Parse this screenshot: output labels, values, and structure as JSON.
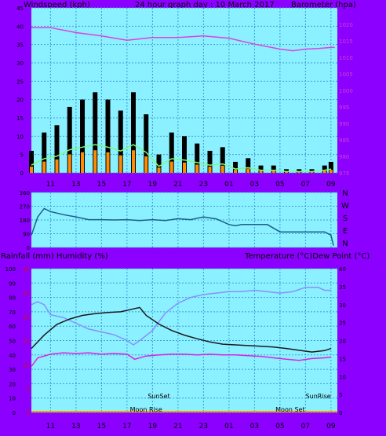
{
  "header": {
    "left_label": "Windspeed (kph)",
    "title": "24 hour graph day : 10 March 2017",
    "right_label": "Barometer (hpa)"
  },
  "bottom_header": {
    "left_label": "Rainfall (mm)  Humidity (%)",
    "right_label": "Temperature (°C)Dew Point (°C)"
  },
  "colors": {
    "plot_bg": "#8bf0ff",
    "grid": "#3c9fd0",
    "windspeed": "#000000",
    "gust_fill": "#ff8c00",
    "avg_wind": "#7cfc7c",
    "barometer": "#e040e0",
    "direction": "#1b5f86",
    "temperature": "#1a1a1a",
    "dew_point": "#e020e0",
    "humidity": "#8890ff",
    "rain": "#ffa000"
  },
  "chart_data": [
    {
      "type": "line",
      "title": "24 hour graph day : 10 March 2017",
      "xlabel": "",
      "ylabel_left": "Windspeed (kph)",
      "ylabel_right": "Barometer (hpa)",
      "x_ticks": [
        "11",
        "13",
        "15",
        "17",
        "19",
        "21",
        "23",
        "01",
        "03",
        "05",
        "07",
        "09"
      ],
      "y_left_ticks": [
        0,
        5,
        10,
        15,
        20,
        25,
        30,
        35,
        40,
        45
      ],
      "ylim_left": [
        0,
        45
      ],
      "y_right_ticks": [
        975,
        980,
        985,
        990,
        995,
        1000,
        1005,
        1010,
        1015,
        1020
      ],
      "ylim_right": [
        975,
        1025
      ],
      "grid": true,
      "series": [
        {
          "name": "Windspeed (kph)",
          "axis": "left",
          "x": [
            9.5,
            10.5,
            11.5,
            12.5,
            13.5,
            14.5,
            15.5,
            16.5,
            17.5,
            18.5,
            19.5,
            20.5,
            21.5,
            22.5,
            23.5,
            24.5,
            25.5,
            26.5,
            27.5,
            28.5,
            29.5,
            30.5,
            31.5,
            32.5,
            33
          ],
          "y": [
            6,
            11,
            13,
            18,
            20,
            22,
            20,
            17,
            22,
            16,
            5,
            11,
            10,
            8,
            6,
            7,
            3,
            4,
            2,
            2,
            1,
            1,
            1,
            2,
            3
          ]
        },
        {
          "name": "Barometer (hpa)",
          "axis": "right",
          "x": [
            9.5,
            11,
            13,
            15,
            17,
            19,
            21,
            23,
            25,
            27,
            29,
            30,
            31,
            32,
            33,
            33.3
          ],
          "y": [
            1019,
            1019,
            1017.5,
            1016.5,
            1015.2,
            1016,
            1016,
            1016.5,
            1015.8,
            1014,
            1012.5,
            1012,
            1012.5,
            1012.7,
            1013,
            1013
          ]
        }
      ]
    },
    {
      "type": "line",
      "title": "",
      "x_ticks": [
        "11",
        "13",
        "15",
        "17",
        "19",
        "21",
        "23",
        "01",
        "03",
        "05",
        "07",
        "09"
      ],
      "y_left_ticks": [
        0,
        90,
        180,
        270,
        360
      ],
      "ylim_left": [
        0,
        360
      ],
      "y_right_labels": [
        "N",
        "W",
        "S",
        "E",
        "N"
      ],
      "grid": true,
      "series": [
        {
          "name": "Wind direction",
          "x": [
            9.5,
            10,
            10.5,
            11,
            12,
            13,
            14,
            15,
            16,
            17,
            18,
            19,
            20,
            21,
            22,
            23,
            24,
            25,
            25.5,
            26,
            27,
            28,
            29,
            30,
            31,
            32,
            32.5,
            33,
            33.2
          ],
          "y": [
            80,
            200,
            255,
            235,
            215,
            200,
            182,
            182,
            180,
            182,
            176,
            182,
            176,
            188,
            182,
            200,
            187,
            150,
            142,
            150,
            150,
            150,
            102,
            102,
            102,
            102,
            102,
            80,
            12
          ]
        }
      ]
    },
    {
      "type": "line",
      "title": "",
      "x_ticks": [
        "11",
        "13",
        "15",
        "17",
        "19",
        "21",
        "23",
        "01",
        "03",
        "05",
        "07",
        "09"
      ],
      "y_left_ticks": [
        0,
        10,
        20,
        30,
        40,
        50,
        60,
        70,
        80,
        90,
        100
      ],
      "ylim_left": [
        0,
        100
      ],
      "y_rain_ticks": [
        0,
        5,
        10,
        15,
        20,
        25,
        30
      ],
      "y_right_ticks": [
        0,
        5,
        10,
        15,
        20,
        25,
        30,
        35,
        40
      ],
      "ylim_right": [
        0,
        40
      ],
      "grid": true,
      "annotations": [
        "SunSet",
        "SunRise",
        "Moon Rise",
        "Moon Set"
      ],
      "series": [
        {
          "name": "Temperature (°C)",
          "axis": "right",
          "x": [
            9.5,
            10.5,
            11.5,
            12.5,
            13.5,
            14.5,
            15.5,
            16.5,
            17.5,
            18,
            18.5,
            19.5,
            20.5,
            21.5,
            22.5,
            23.5,
            24.5,
            25.5,
            26.5,
            27.5,
            28.5,
            29.5,
            30.5,
            31.5,
            32.5,
            33
          ],
          "y": [
            17.8,
            21.5,
            24.5,
            26,
            27,
            27.5,
            27.8,
            28,
            28.8,
            29.2,
            27,
            24.6,
            22.8,
            21.5,
            20.5,
            19.6,
            19,
            18.8,
            18.6,
            18.4,
            18.2,
            17.8,
            17.3,
            16.8,
            17.2,
            17.8
          ]
        },
        {
          "name": "Dew Point (°C)",
          "axis": "right",
          "x": [
            9.5,
            10,
            11,
            12,
            13,
            14,
            15,
            16,
            17,
            17.6,
            18.5,
            19.5,
            20.5,
            21.5,
            22.5,
            23.5,
            24.5,
            25.5,
            26.5,
            27.5,
            28.5,
            29.5,
            30.5,
            31.5,
            32.5,
            33
          ],
          "y": [
            12.8,
            15.2,
            16.2,
            16.6,
            16.4,
            16.6,
            16.2,
            16.4,
            16.2,
            14.8,
            15.7,
            16,
            16.2,
            16.2,
            16,
            16.2,
            16,
            16,
            15.8,
            15.6,
            15.2,
            14.8,
            14.5,
            15,
            15.2,
            15.4
          ]
        },
        {
          "name": "Humidity (%)",
          "axis": "left",
          "x": [
            9.5,
            10,
            10.5,
            11,
            12,
            13,
            14,
            15,
            16,
            17,
            17.5,
            18,
            19,
            20,
            21,
            22,
            23,
            24,
            25,
            26,
            27,
            28,
            29,
            30,
            31,
            32,
            32.5,
            33
          ],
          "y": [
            75,
            77,
            75,
            68,
            66,
            62,
            58,
            56,
            54,
            50,
            47,
            50,
            57,
            69,
            76,
            80,
            82,
            83,
            84,
            84,
            85,
            84,
            83,
            84,
            87,
            87,
            85,
            85
          ]
        }
      ]
    }
  ]
}
